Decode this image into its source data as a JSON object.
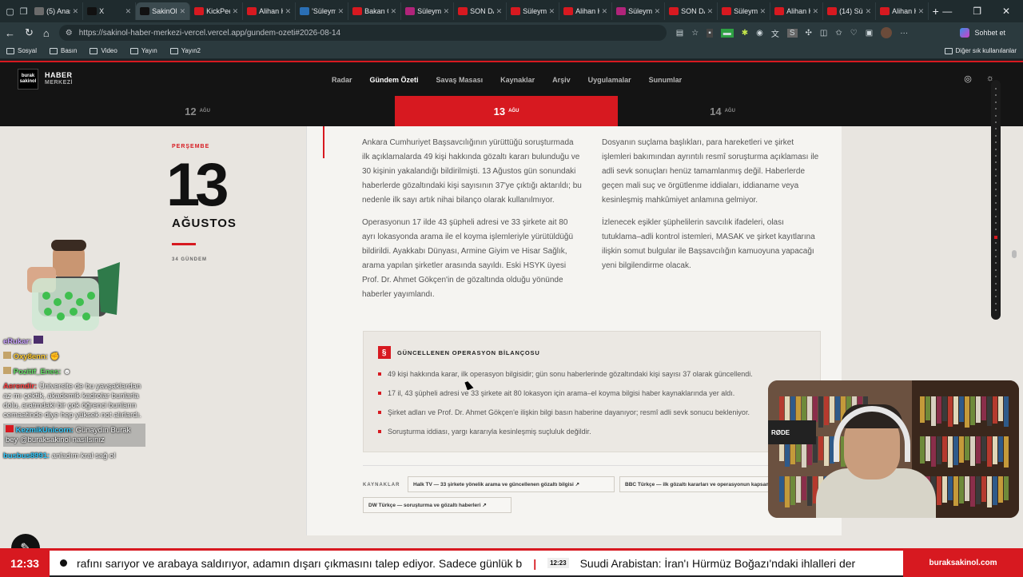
{
  "browser": {
    "tabs": [
      {
        "label": "(5) Anas",
        "color": "#6b6b6b"
      },
      {
        "label": "X",
        "color": "#111111"
      },
      {
        "label": "SakinOl",
        "color": "#111111",
        "active": true
      },
      {
        "label": "KickPee",
        "color": "#d71920"
      },
      {
        "label": "Alihan K",
        "color": "#d71920"
      },
      {
        "label": "'Süleym",
        "color": "#2a6fb5"
      },
      {
        "label": "Bakan Ç",
        "color": "#d71920"
      },
      {
        "label": "Süleyma",
        "color": "#b0247a"
      },
      {
        "label": "SON DA",
        "color": "#d71920"
      },
      {
        "label": "Süleyma",
        "color": "#d71920"
      },
      {
        "label": "Alihan K",
        "color": "#d71920"
      },
      {
        "label": "Süleyma",
        "color": "#b0247a"
      },
      {
        "label": "SON DA",
        "color": "#d71920"
      },
      {
        "label": "Süleyma",
        "color": "#d71920"
      },
      {
        "label": "Alihan K",
        "color": "#d71920"
      },
      {
        "label": "(14) Sül",
        "color": "#d71920"
      },
      {
        "label": "Alihan K",
        "color": "#d71920"
      }
    ],
    "url": "https://sakinol-haber-merkezi-vercel.vercel.app/gundem-ozeti#2026-08-14",
    "sohbet": "Sohbet et",
    "bookmarks": [
      "Sosyal",
      "Basın",
      "Video",
      "Yayın",
      "Yayın2"
    ],
    "bookmarks_right": "Diğer sık kullanılanlar"
  },
  "site": {
    "logo_box": "burak sakinol",
    "logo_title": "HABER",
    "logo_sub": "MERKEZİ",
    "menu": [
      "Radar",
      "Gündem Özeti",
      "Savaş Masası",
      "Kaynaklar",
      "Arşiv",
      "Uygulamalar",
      "Sunumlar"
    ],
    "dates": [
      {
        "day": "12",
        "mon": "AĞU"
      },
      {
        "day": "13",
        "mon": "AĞU"
      },
      {
        "day": "14",
        "mon": "AĞU"
      }
    ],
    "weekday": "PERŞEMBE",
    "bigday": "13",
    "month": "AĞUSTOS",
    "gundem_count": "34 GÜNDEM"
  },
  "article": {
    "left_paragraphs": [
      "Ankara Cumhuriyet Başsavcılığının yürüttüğü soruşturmada ilk açıklamalarda 49 kişi hakkında gözaltı kararı bulunduğu ve 30 kişinin yakalandığı bildirilmişti. 13 Ağustos gün sonundaki haberlerde gözaltındaki kişi sayısının 37'ye çıktığı aktarıldı; bu nedenle ilk sayı artık nihai bilanço olarak kullanılmıyor.",
      "Operasyonun 17 ilde 43 şüpheli adresi ve 33 şirkete ait 80 ayrı lokasyonda arama ile el koyma işlemleriyle yürütüldüğü bildirildi. Ayakkabı Dünyası, Armine Giyim ve Hisar Sağlık, arama yapılan şirketler arasında sayıldı. Eski HSYK üyesi Prof. Dr. Ahmet Gökçen'in de gözaltında olduğu yönünde haberler yayımlandı."
    ],
    "right_paragraphs": [
      "Dosyanın suçlama başlıkları, para hareketleri ve şirket işlemleri bakımından ayrıntılı resmî soruşturma açıklaması ile adli sevk sonuçları henüz tamamlanmış değil. Haberlerde geçen mali suç ve örgütlenme iddiaları, iddianame veya kesinleşmiş mahkûmiyet anlamına gelmiyor.",
      "İzlenecek eşikler şüphelilerin savcılık ifadeleri, olası tutuklama–adli kontrol istemleri, MASAK ve şirket kayıtlarına ilişkin somut bulgular ile Başsavcılığın kamuoyuna yapacağı yeni bilgilendirme olacak."
    ],
    "box_icon": "§",
    "box_title": "GÜNCELLENEN OPERASYON BİLANÇOSU",
    "bullets": [
      "49 kişi hakkında karar, ilk operasyon bilgisidir; gün sonu haberlerinde gözaltındaki kişi sayısı 37 olarak güncellendi.",
      "17 il, 43 şüpheli adresi ve 33 şirkete ait 80 lokasyon için arama–el koyma bilgisi haber kaynaklarında yer aldı.",
      "Şirket adları ve Prof. Dr. Ahmet Gökçen'e ilişkin bilgi basın haberine dayanıyor; resmî adli sevk sonucu bekleniyor.",
      "Soruşturma iddiası, yargı kararıyla kesinleşmiş suçluluk değildir."
    ],
    "sources_label": "KAYNAKLAR",
    "sources": [
      "Halk TV — 33 şirkete yönelik arama ve güncellenen gözaltı bilgisi ↗",
      "BBC Türkçe — ilk gözaltı kararları ve operasyonun kapsamı ↗",
      "DW Türkçe — soruşturma ve gözaltı haberleri ↗"
    ]
  },
  "chat": [
    {
      "user": "eRukar:",
      "text": "",
      "color": "#c9a2ff"
    },
    {
      "user": "Oxy8enn:",
      "text": "",
      "color": "#ffcc33"
    },
    {
      "user": "Pozitif_Enes:",
      "text": "",
      "color": "#66dd66"
    },
    {
      "user": "Aerendir:",
      "text": "Üniversite de bu yavşaklardan az mı çektik, akademik kadrolar bunlarla dolu, aratmdaki bir çok öğrenci bunların cemaatinde diye hep yüksek not alırlardı.",
      "color": "#ff4444"
    },
    {
      "user": "KezmikUnicorn:",
      "text": "Günaydın Burak bey @buraksakinol nasılsınız",
      "color": "#33ccff",
      "boxed": true
    },
    {
      "user": "busbus8991:",
      "text": "anladım kral sağ ol",
      "color": "#33ccff"
    }
  ],
  "cam": {
    "mic_label": "RØDE"
  },
  "ticker": {
    "clock": "12:33",
    "text1": "rafını sarıyor ve arabaya saldırıyor, adamın dışarı çıkmasını talep ediyor. Sadece günlük b",
    "time2": "12:23",
    "text2": "Suudi Arabistan: İran'ı Hürmüz Boğazı'ndaki ihlalleri der",
    "brand": "buraksakinol.com"
  }
}
